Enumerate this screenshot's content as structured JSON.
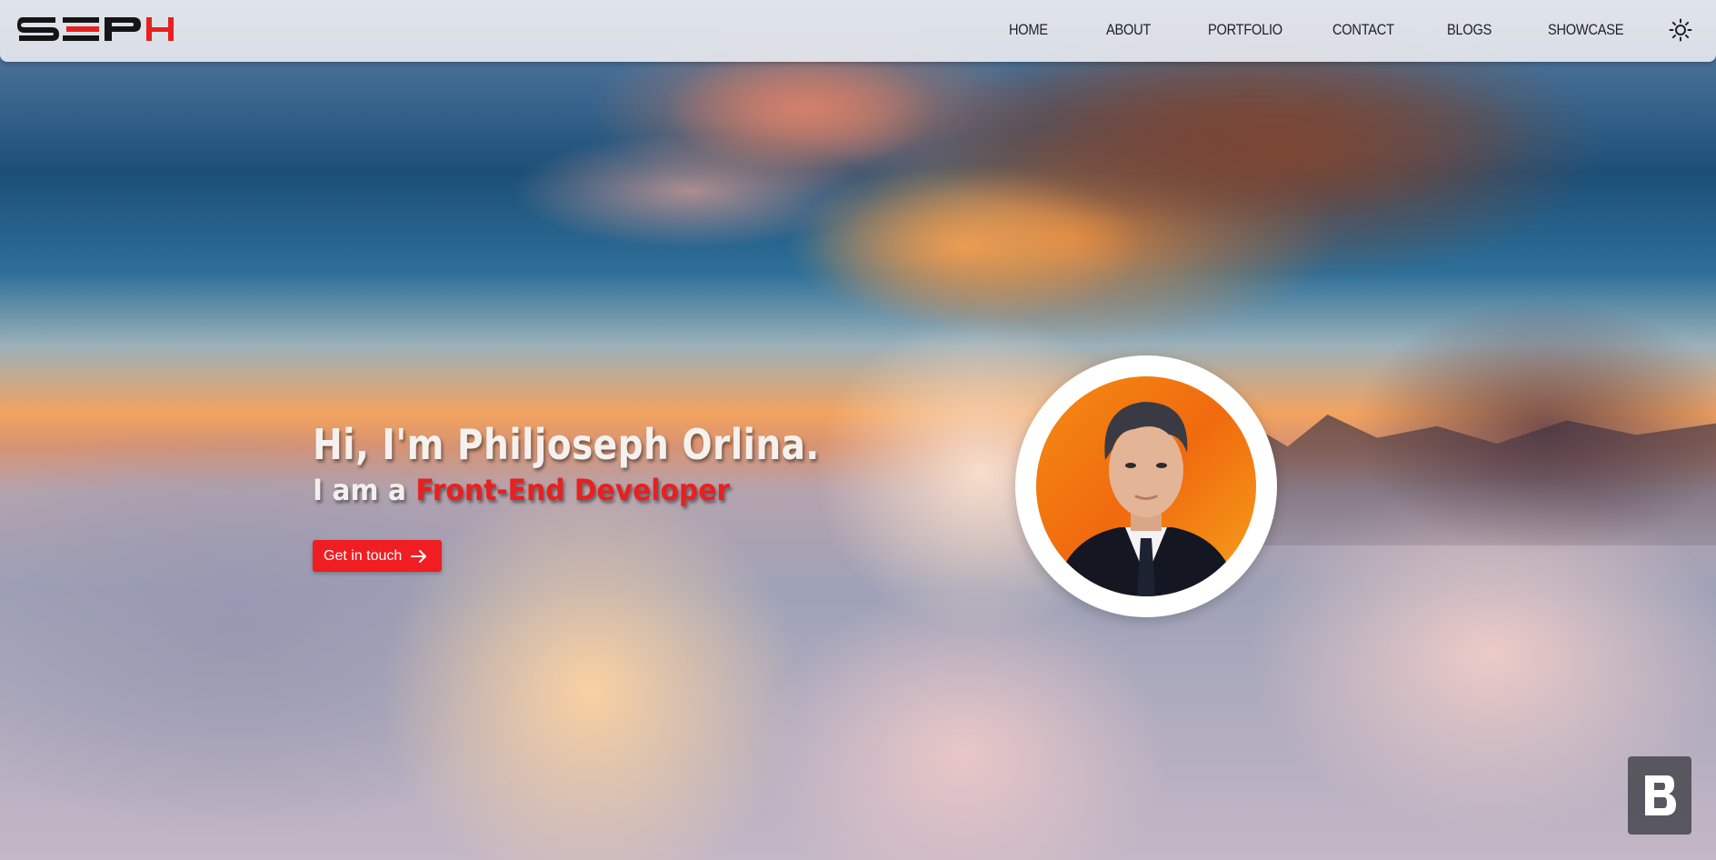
{
  "brand": {
    "logo_text": "SEPH",
    "accent": "#e8201f"
  },
  "nav": {
    "items": [
      {
        "label": "HOME"
      },
      {
        "label": "ABOUT"
      },
      {
        "label": "PORTFOLIO"
      },
      {
        "label": "CONTACT"
      },
      {
        "label": "BLOGS"
      },
      {
        "label": "SHOWCASE"
      }
    ],
    "theme_toggle_icon": "sun-icon"
  },
  "hero": {
    "title": "Hi, I'm Philjoseph Orlina.",
    "subtitle_prefix": "I am a ",
    "role": "Front-End Developer",
    "cta_label": "Get in touch",
    "cta_icon": "arrow-right-icon"
  },
  "profile": {
    "image": "profile-photo"
  },
  "floating_badge": {
    "icon": "b-logo-icon"
  },
  "colors": {
    "cta_bg": "#f01e22",
    "nav_bg": "#e6e8ee",
    "text_light": "#f4f1ee"
  }
}
